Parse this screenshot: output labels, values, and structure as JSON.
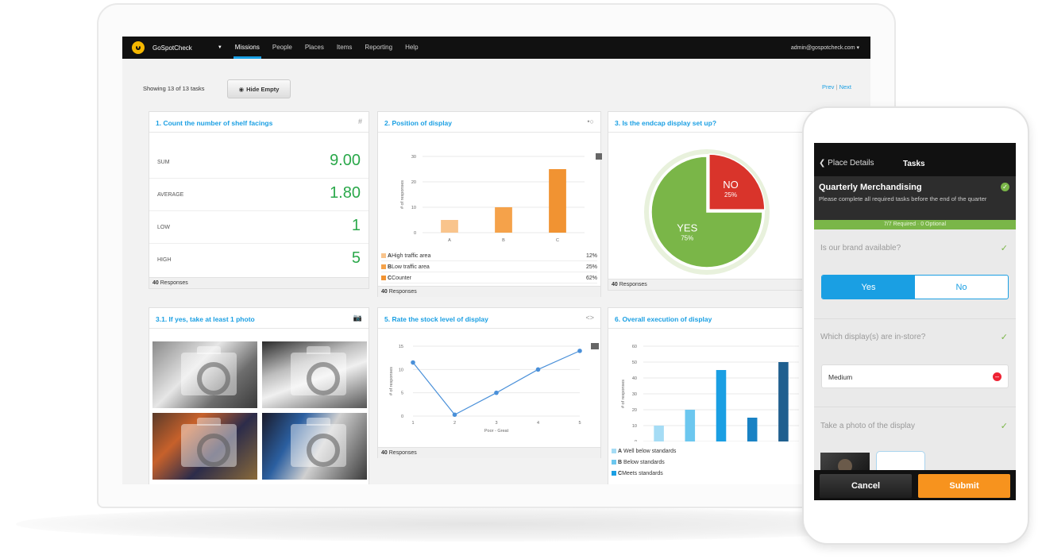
{
  "navbar": {
    "brand": "GoSpotCheck",
    "links": [
      "Missions",
      "People",
      "Places",
      "Items",
      "Reporting",
      "Help"
    ],
    "account": "admin@gospotcheck.com"
  },
  "toolbar": {
    "showing": "Showing 13 of 13 tasks",
    "hide_empty": "Hide Empty",
    "prev": "Prev",
    "next": "Next"
  },
  "cards": {
    "c1": {
      "title": "1. Count the number of shelf facings",
      "stats": [
        {
          "label": "SUM",
          "value": "9.00"
        },
        {
          "label": "AVERAGE",
          "value": "1.80"
        },
        {
          "label": "LOW",
          "value": "1"
        },
        {
          "label": "HIGH",
          "value": "5"
        }
      ],
      "responses_count": "40",
      "responses_label": "Responses"
    },
    "c2": {
      "title": "2. Position of display",
      "legend": [
        {
          "key": "A",
          "label": "High traffic area",
          "pct": "12%",
          "color": "#f9c48c"
        },
        {
          "key": "B",
          "label": "Low traffic area",
          "pct": "25%",
          "color": "#f5a24a"
        },
        {
          "key": "C",
          "label": "Counter",
          "pct": "62%",
          "color": "#f19332"
        }
      ],
      "responses_count": "40",
      "responses_label": "Responses"
    },
    "c3": {
      "title": "3. Is the endcap display set up?",
      "responses_count": "40",
      "responses_label": "Responses"
    },
    "c4": {
      "title": "3.1. If yes, take at least 1 photo"
    },
    "c5": {
      "title": "5. Rate the stock level of display",
      "responses_count": "40",
      "responses_label": "Responses"
    },
    "c6": {
      "title": "6. Overall execution of display",
      "legend": [
        {
          "key": "A",
          "label": "Well below standards",
          "color": "#a5dcf5"
        },
        {
          "key": "B",
          "label": "Below standards",
          "color": "#6cc7ef"
        },
        {
          "key": "C",
          "label": "Meets standards",
          "color": "#1a9fe3"
        }
      ]
    }
  },
  "chart_data": [
    {
      "type": "bar",
      "categories": [
        "A",
        "B",
        "C"
      ],
      "values": [
        5,
        10,
        25
      ],
      "ylabel": "# of responses",
      "ylim": [
        0,
        30
      ],
      "yticks": [
        "0",
        "10",
        "20",
        "30"
      ],
      "colors": [
        "#f9c48c",
        "#f5a24a",
        "#f19332"
      ]
    },
    {
      "type": "pie",
      "slices": [
        {
          "label": "YES",
          "pct_label": "75%",
          "value": 75,
          "color": "#7ab648"
        },
        {
          "label": "NO",
          "pct_label": "25%",
          "value": 25,
          "color": "#d9342b"
        }
      ]
    },
    {
      "type": "line",
      "x": [
        1,
        2,
        3,
        4,
        5
      ],
      "values": [
        11.5,
        0.3,
        5,
        10,
        14
      ],
      "xlabel": "Poor - Great",
      "ylabel": "# of responses",
      "ylim": [
        0,
        15
      ],
      "yticks": [
        "0",
        "5",
        "10",
        "15"
      ],
      "xticks": [
        "1",
        "2",
        "3",
        "4",
        "5"
      ],
      "color": "#4a90d9"
    },
    {
      "type": "bar",
      "categories": [
        "A",
        "B",
        "C",
        "D",
        "E"
      ],
      "values": [
        10,
        20,
        45,
        15,
        50
      ],
      "ylabel": "# of responses",
      "ylim": [
        0,
        60
      ],
      "yticks": [
        "0",
        "10",
        "20",
        "30",
        "40",
        "50",
        "60"
      ],
      "colors": [
        "#a5dcf5",
        "#6cc7ef",
        "#1a9fe3",
        "#1982c4",
        "#1f5f8f"
      ]
    }
  ],
  "phone": {
    "back": "Place Details",
    "title": "Tasks",
    "mission_title": "Quarterly Merchandising",
    "mission_desc": "Please complete all required tasks before the end of the quarter",
    "progress": "7/7 Required · 0 Optional",
    "q1": "Is our brand available?",
    "yes": "Yes",
    "no": "No",
    "q2": "Which display(s) are in-store?",
    "selected": "Medium",
    "q3": "Take a photo of the display",
    "cancel": "Cancel",
    "submit": "Submit"
  }
}
